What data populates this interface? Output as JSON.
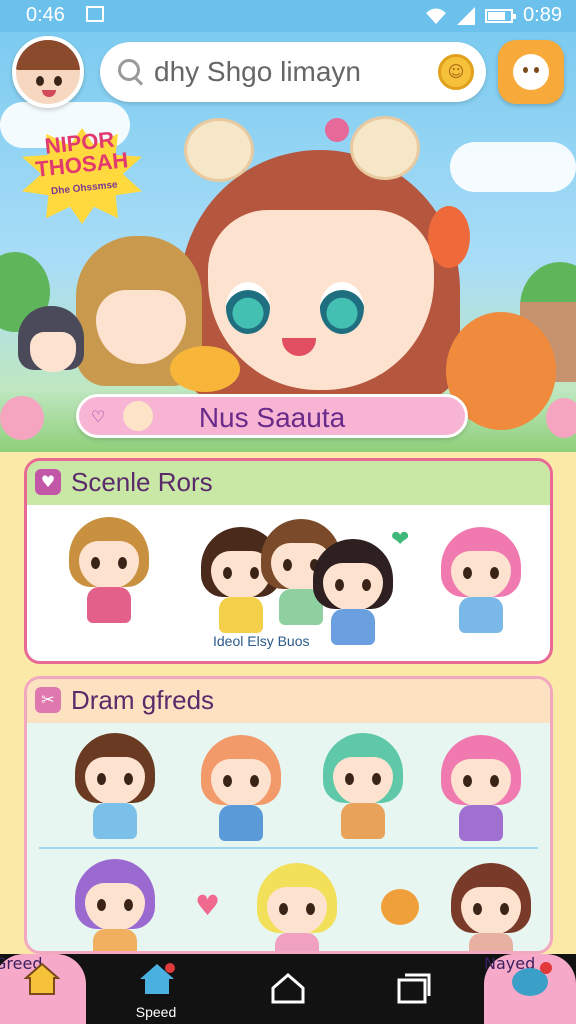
{
  "status_bar": {
    "time_left": "0:46",
    "time_right": "0:89"
  },
  "search": {
    "placeholder": "dhy Shgo limayn"
  },
  "promo": {
    "line1": "NIPOR",
    "line2": "THOSAH",
    "sub": "Dhe Ohssmse"
  },
  "banner": {
    "title": "Nus Saauta"
  },
  "section1": {
    "title": "Scenle Rors",
    "caption": "Ideol Elsy  Buos"
  },
  "section2": {
    "title": "Dram gfreds"
  },
  "nav": {
    "items": [
      {
        "label": "Greed"
      },
      {
        "label": "Speed"
      },
      {
        "label": "Nayed"
      }
    ]
  },
  "colors": {
    "accent_pink": "#e86a94",
    "sky": "#7ccbf0",
    "banner": "#f7b5d3"
  }
}
